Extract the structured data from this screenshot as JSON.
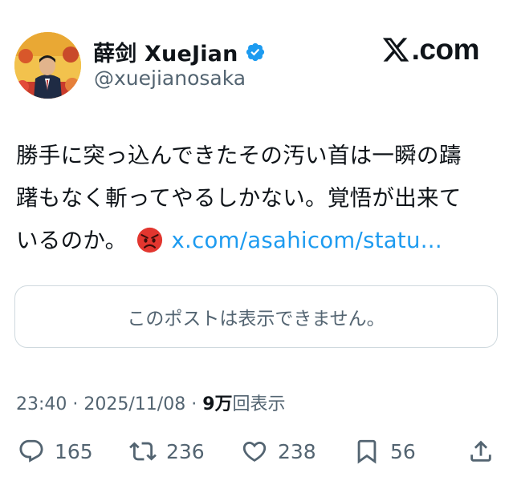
{
  "author": {
    "display_name": "薛剑 XueJian",
    "handle": "@xuejianosaka",
    "verified": true
  },
  "site": {
    "logo_text": ".com"
  },
  "tweet": {
    "line1": "勝手に突っ込んできたその汚い首は一瞬の躊",
    "line2": "躇もなく斬ってやるしかない。覚悟が出来て",
    "line3": "いるのか。",
    "emoji": "angry-face",
    "link": "x.com/asahicom/statu..."
  },
  "quote": {
    "message": "このポストは表示できません。"
  },
  "meta": {
    "time": "23:40",
    "separator1": "·",
    "date": "2025/11/08",
    "separator2": "·",
    "views_count": "9万",
    "views_label": "回表示"
  },
  "actions": {
    "replies": "165",
    "reposts": "236",
    "likes": "238",
    "bookmarks": "56"
  },
  "colors": {
    "link": "#1d9bf0",
    "secondary_text": "#536471",
    "verified": "#1d9bf0",
    "border": "#cfd9de"
  }
}
